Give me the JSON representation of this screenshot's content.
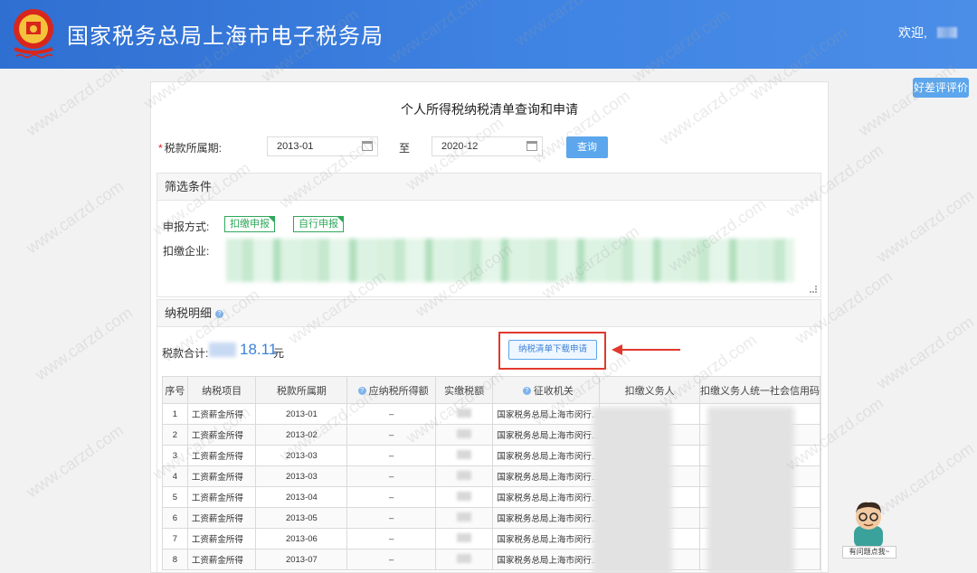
{
  "header": {
    "site_title": "国家税务总局上海市电子税务局",
    "welcome": "欢迎,"
  },
  "review_button": "好差评评价",
  "panel": {
    "title": "个人所得税纳税清单查询和申请",
    "period_label": "税款所属期:",
    "required_mark": "*",
    "date_from": "2013-01",
    "to_label": "至",
    "date_to": "2020-12",
    "query_label": "查询"
  },
  "filter": {
    "heading": "筛选条件",
    "declare_label": "申报方式:",
    "tags": [
      "扣缴申报",
      "自行申报"
    ],
    "enterprise_label": "扣缴企业:"
  },
  "detail": {
    "heading": "纳税明细",
    "total_label": "税款合计:",
    "total_value": "18.11",
    "total_unit": "元",
    "download_label": "纳税清单下载申请"
  },
  "table": {
    "headers": [
      "序号",
      "纳税项目",
      "税款所属期",
      "应纳税所得额",
      "实缴税额",
      "征收机关",
      "扣缴义务人",
      "扣缴义务人统一社会信用码"
    ],
    "rows": [
      [
        "1",
        "工资薪金所得",
        "2013-01",
        "–",
        "",
        "国家税务总局上海市闵行..."
      ],
      [
        "2",
        "工资薪金所得",
        "2013-02",
        "–",
        "",
        "国家税务总局上海市闵行..."
      ],
      [
        "3",
        "工资薪金所得",
        "2013-03",
        "–",
        "",
        "国家税务总局上海市闵行..."
      ],
      [
        "4",
        "工资薪金所得",
        "2013-03",
        "–",
        "",
        "国家税务总局上海市闵行..."
      ],
      [
        "5",
        "工资薪金所得",
        "2013-04",
        "–",
        "",
        "国家税务总局上海市闵行..."
      ],
      [
        "6",
        "工资薪金所得",
        "2013-05",
        "–",
        "",
        "国家税务总局上海市闵行..."
      ],
      [
        "7",
        "工资薪金所得",
        "2013-06",
        "–",
        "",
        "国家税务总局上海市闵行..."
      ],
      [
        "8",
        "工资薪金所得",
        "2013-07",
        "–",
        "",
        "国家税务总局上海市闵行..."
      ]
    ]
  },
  "assistant_label": "有问题点我~",
  "watermark_text": "www.carzd.com",
  "colors": {
    "header_blue": "#3f83e3",
    "button_blue": "#5ba6ec",
    "tag_green": "#2fa85a",
    "highlight_red": "#e0392d"
  }
}
